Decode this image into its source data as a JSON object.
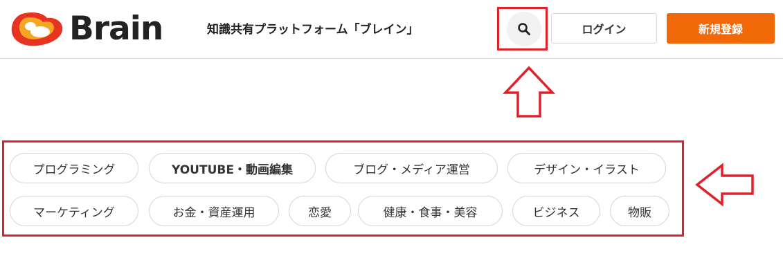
{
  "header": {
    "logo_text": "Brain",
    "tagline": "知識共有プラットフォーム「ブレイン」",
    "search_icon": "search-icon",
    "login_label": "ログイン",
    "signup_label": "新規登録"
  },
  "categories": [
    "プログラミング",
    "YOUTUBE・動画編集",
    "ブログ・メディア運営",
    "デザイン・イラスト",
    "マーケティング",
    "お金・資産運用",
    "恋愛",
    "健康・食事・美容",
    "ビジネス",
    "物販"
  ],
  "annotations": {
    "color": "#e0202a",
    "arrow_up_icon": "arrow-up-outline-icon",
    "arrow_left_icon": "arrow-left-outline-icon"
  },
  "colors": {
    "accent": "#f06808",
    "logo_orange": "#f26a1b",
    "logo_red": "#e63322"
  }
}
